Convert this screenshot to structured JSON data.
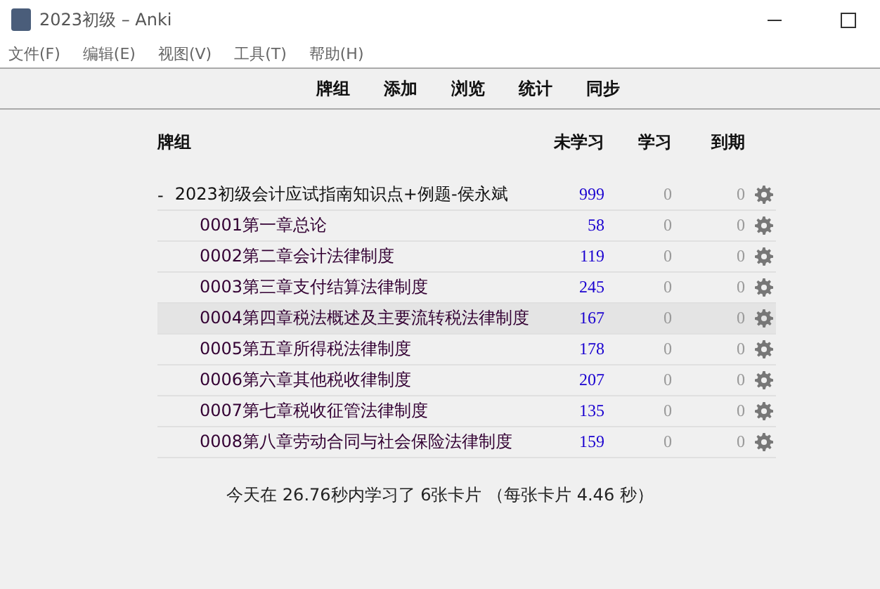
{
  "window": {
    "title": "2023初级 – Anki"
  },
  "menu": [
    "文件(F)",
    "编辑(E)",
    "视图(V)",
    "工具(T)",
    "帮助(H)"
  ],
  "toolbar": [
    "牌组",
    "添加",
    "浏览",
    "统计",
    "同步"
  ],
  "table": {
    "columns": [
      "牌组",
      "未学习",
      "学习",
      "到期"
    ],
    "rows": [
      {
        "name": "2023初级会计应试指南知识点+例题-侯永斌",
        "collapse": "-",
        "expanded": true,
        "selected": false,
        "new": "999",
        "learn": "0",
        "due": "0",
        "children": [
          {
            "name": "0001第一章总论",
            "selected": false,
            "new": "58",
            "learn": "0",
            "due": "0"
          },
          {
            "name": "0002第二章会计法律制度",
            "selected": false,
            "new": "119",
            "learn": "0",
            "due": "0"
          },
          {
            "name": "0003第三章支付结算法律制度",
            "selected": false,
            "new": "245",
            "learn": "0",
            "due": "0"
          },
          {
            "name": "0004第四章税法概述及主要流转税法律制度",
            "selected": true,
            "new": "167",
            "learn": "0",
            "due": "0"
          },
          {
            "name": "0005第五章所得税法律制度",
            "selected": false,
            "new": "178",
            "learn": "0",
            "due": "0"
          },
          {
            "name": "0006第六章其他税收律制度",
            "selected": false,
            "new": "207",
            "learn": "0",
            "due": "0"
          },
          {
            "name": "0007第七章税收征管法律制度",
            "selected": false,
            "new": "135",
            "learn": "0",
            "due": "0"
          },
          {
            "name": "0008第八章劳动合同与社会保险法律制度",
            "selected": false,
            "new": "159",
            "learn": "0",
            "due": "0"
          }
        ]
      }
    ]
  },
  "summary": "今天在 26.76秒内学习了 6张卡片 （每张卡片 4.46 秒）"
}
